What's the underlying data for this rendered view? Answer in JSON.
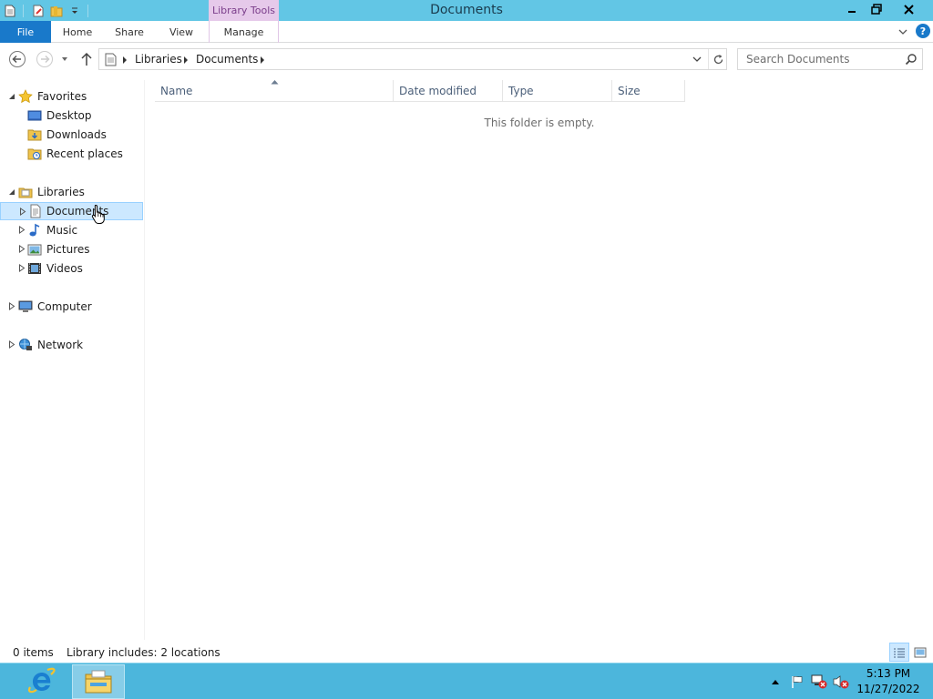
{
  "window": {
    "title": "Documents",
    "context_tab": "Library Tools"
  },
  "ribbon": {
    "tabs": [
      "File",
      "Home",
      "Share",
      "View",
      "Manage"
    ],
    "help": "?"
  },
  "address": {
    "crumbs": [
      "Libraries",
      "Documents"
    ]
  },
  "search": {
    "placeholder": "Search Documents"
  },
  "nav": {
    "favorites": {
      "label": "Favorites",
      "items": [
        "Desktop",
        "Downloads",
        "Recent places"
      ]
    },
    "libraries": {
      "label": "Libraries",
      "items": [
        "Documents",
        "Music",
        "Pictures",
        "Videos"
      ],
      "selected": "Documents"
    },
    "computer": "Computer",
    "network": "Network"
  },
  "columns": [
    "Name",
    "Date modified",
    "Type",
    "Size"
  ],
  "content": {
    "empty_message": "This folder is empty."
  },
  "status": {
    "item_count": "0 items",
    "library_info": "Library includes: 2 locations"
  },
  "taskbar": {
    "time": "5:13 PM",
    "date": "11/27/2022"
  },
  "colors": {
    "titlebar": "#62c6e5",
    "file_tab": "#1979ca",
    "context_tab": "#e6c9ea",
    "selection": "#cce8ff",
    "taskbar": "#4cb6dc"
  }
}
